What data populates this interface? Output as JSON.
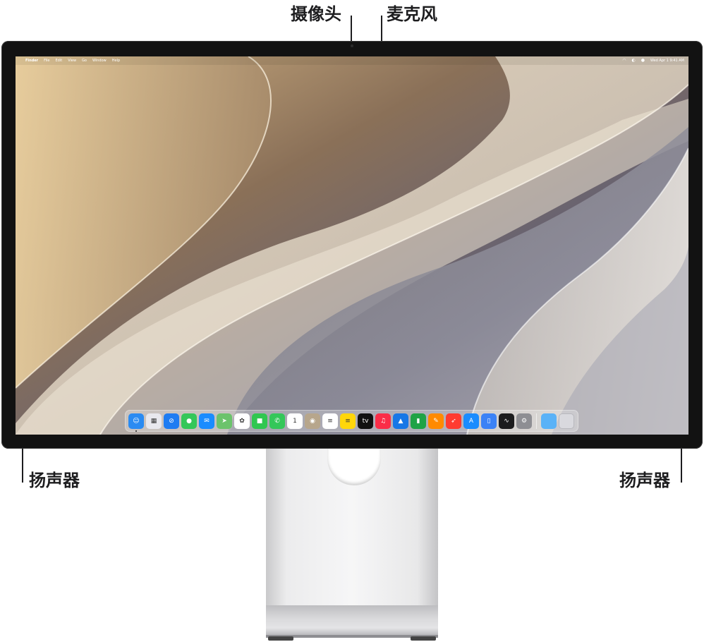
{
  "callouts": {
    "camera": "摄像头",
    "microphone": "麦克风",
    "speaker_left": "扬声器",
    "speaker_right": "扬声器"
  },
  "menubar": {
    "apple": "",
    "items": [
      "Finder",
      "File",
      "Edit",
      "View",
      "Go",
      "Window",
      "Help"
    ],
    "status": {
      "wifi": "wifi-icon",
      "control_center": "control-center-icon",
      "siri": "siri-icon",
      "datetime": "Wed Apr 1  9:41 AM"
    }
  },
  "dock": {
    "apps": [
      {
        "name": "Finder",
        "icon": "finder-icon",
        "color": "#2a8bf2",
        "glyph": "☺",
        "running": true
      },
      {
        "name": "Launchpad",
        "icon": "launchpad-icon",
        "color": "#e8e8ee",
        "glyph": "▦"
      },
      {
        "name": "Safari",
        "icon": "safari-icon",
        "color": "#1e7cf2",
        "glyph": "⊘"
      },
      {
        "name": "Messages",
        "icon": "messages-icon",
        "color": "#34c759",
        "glyph": "●"
      },
      {
        "name": "Mail",
        "icon": "mail-icon",
        "color": "#1a8cff",
        "glyph": "✉"
      },
      {
        "name": "Maps",
        "icon": "maps-icon",
        "color": "#6cc36c",
        "glyph": "➤"
      },
      {
        "name": "Photos",
        "icon": "photos-icon",
        "color": "#ffffff",
        "glyph": "✿"
      },
      {
        "name": "FaceTime",
        "icon": "facetime-icon",
        "color": "#30c750",
        "glyph": "■"
      },
      {
        "name": "Phone",
        "icon": "phone-icon",
        "color": "#34c759",
        "glyph": "✆"
      },
      {
        "name": "Calendar",
        "icon": "calendar-icon",
        "color": "#ffffff",
        "glyph": "1"
      },
      {
        "name": "Contacts",
        "icon": "contacts-icon",
        "color": "#b7a68c",
        "glyph": "◉"
      },
      {
        "name": "Reminders",
        "icon": "reminders-icon",
        "color": "#ffffff",
        "glyph": "≡"
      },
      {
        "name": "Notes",
        "icon": "notes-icon",
        "color": "#ffd60a",
        "glyph": "≡"
      },
      {
        "name": "TV",
        "icon": "tv-icon",
        "color": "#111111",
        "glyph": "tv"
      },
      {
        "name": "Music",
        "icon": "music-icon",
        "color": "#fa2d48",
        "glyph": "♫"
      },
      {
        "name": "Keynote",
        "icon": "keynote-icon",
        "color": "#1777e6",
        "glyph": "▲"
      },
      {
        "name": "Numbers",
        "icon": "numbers-icon",
        "color": "#1fa346",
        "glyph": "▮"
      },
      {
        "name": "Pages",
        "icon": "pages-icon",
        "color": "#ff8a00",
        "glyph": "✎"
      },
      {
        "name": "Rocket",
        "icon": "rocket-icon",
        "color": "#ff3b30",
        "glyph": "➶"
      },
      {
        "name": "App Store",
        "icon": "app-store-icon",
        "color": "#1a8cff",
        "glyph": "A"
      },
      {
        "name": "iPhone Mirroring",
        "icon": "iphone-mirroring-icon",
        "color": "#3b82f6",
        "glyph": "▯"
      },
      {
        "name": "Activity Monitor",
        "icon": "activity-monitor-icon",
        "color": "#1c1c1e",
        "glyph": "∿"
      },
      {
        "name": "System Settings",
        "icon": "settings-icon",
        "color": "#8e8e93",
        "glyph": "⚙"
      }
    ],
    "folder": {
      "name": "Downloads",
      "icon": "folder-icon",
      "color": "#5ab2f7"
    },
    "trash": {
      "name": "Trash",
      "icon": "trash-icon",
      "color": "#d9d9de"
    }
  }
}
